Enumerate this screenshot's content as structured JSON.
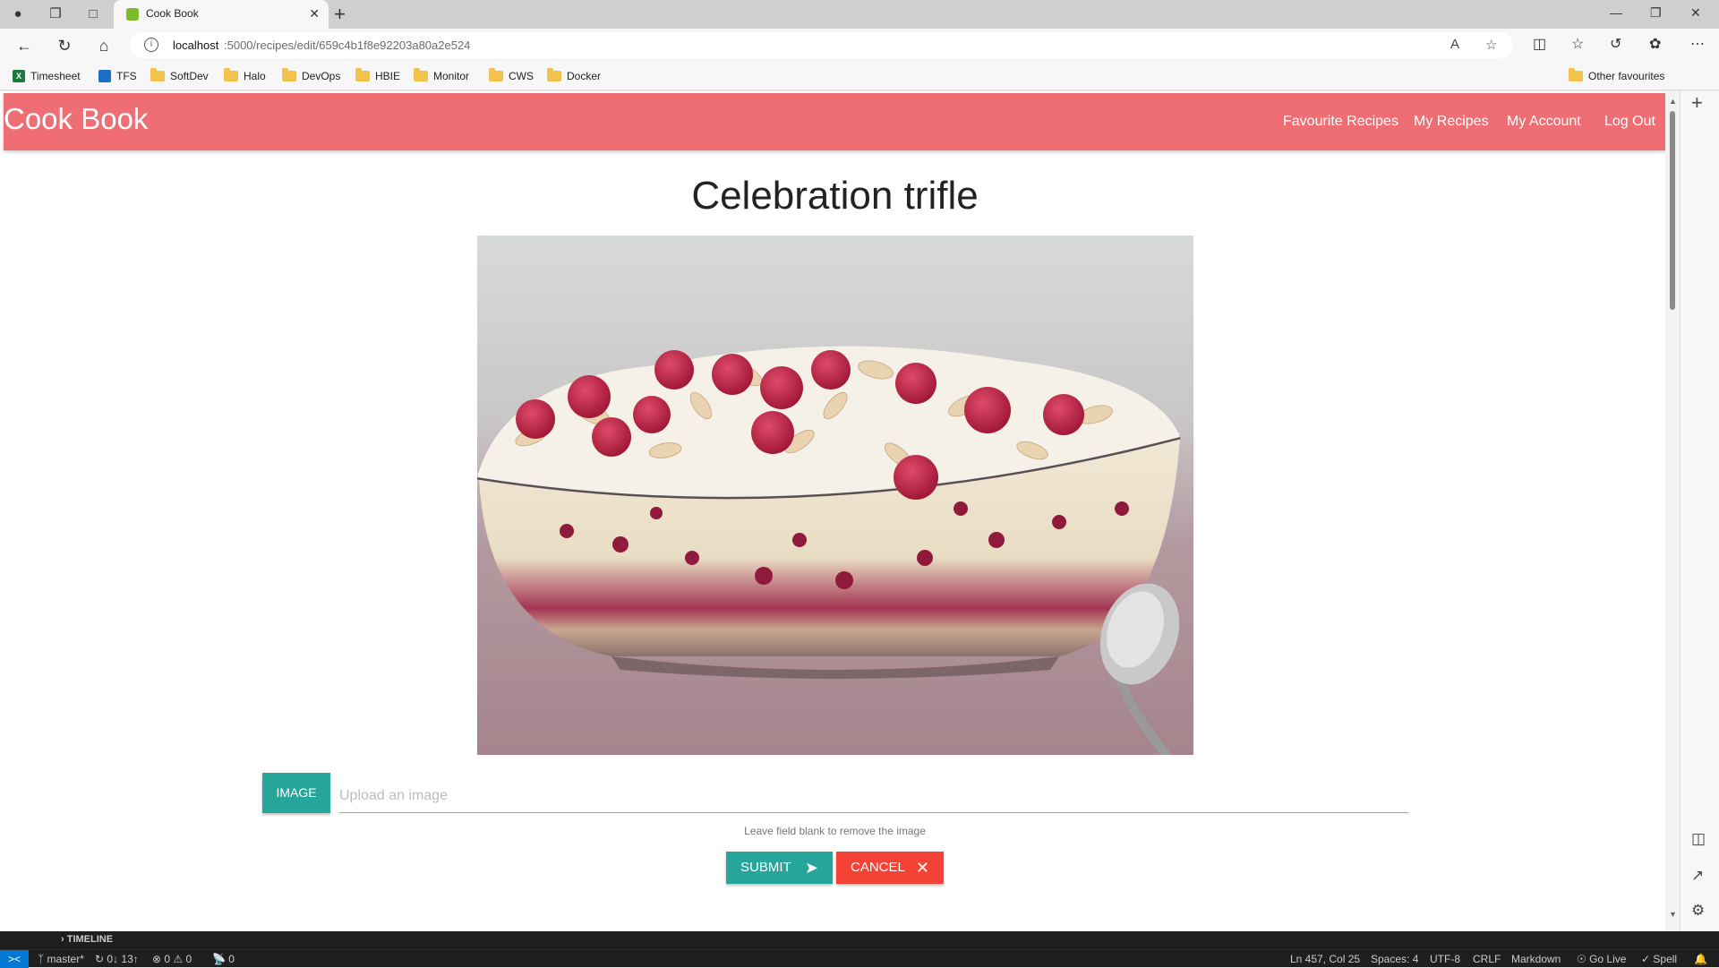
{
  "browser": {
    "tab_title": "Cook Book",
    "url_host": "localhost",
    "url_path": ":5000/recipes/edit/659c4b1f8e92203a80a2e524",
    "bookmarks": [
      "Timesheet",
      "TFS",
      "SoftDev",
      "Halo",
      "DevOps",
      "HBIE",
      "Monitor",
      "CWS",
      "Docker"
    ],
    "other_favourites": "Other favourites"
  },
  "app": {
    "brand": "Cook Book",
    "nav": [
      "Favourite Recipes",
      "My Recipes",
      "My Account",
      "Log Out"
    ]
  },
  "recipe": {
    "title": "Celebration trifle"
  },
  "form": {
    "image_button": "IMAGE",
    "image_placeholder": "Upload an image",
    "helper": "Leave field blank to remove the image",
    "submit": "SUBMIT",
    "cancel": "CANCEL"
  },
  "vscode": {
    "timeline": "TIMELINE",
    "branch": "master*",
    "sync": "0↓ 13↑",
    "problems": "0 ⚠ 0",
    "ports": "0",
    "position": "Ln 457, Col 25",
    "spaces": "Spaces: 4",
    "encoding": "UTF-8",
    "eol": "CRLF",
    "language": "Markdown",
    "golive": "Go Live",
    "spell": "Spell"
  },
  "colors": {
    "navbar": "#ef6e73",
    "teal": "#26a69a",
    "red": "#f44336"
  }
}
